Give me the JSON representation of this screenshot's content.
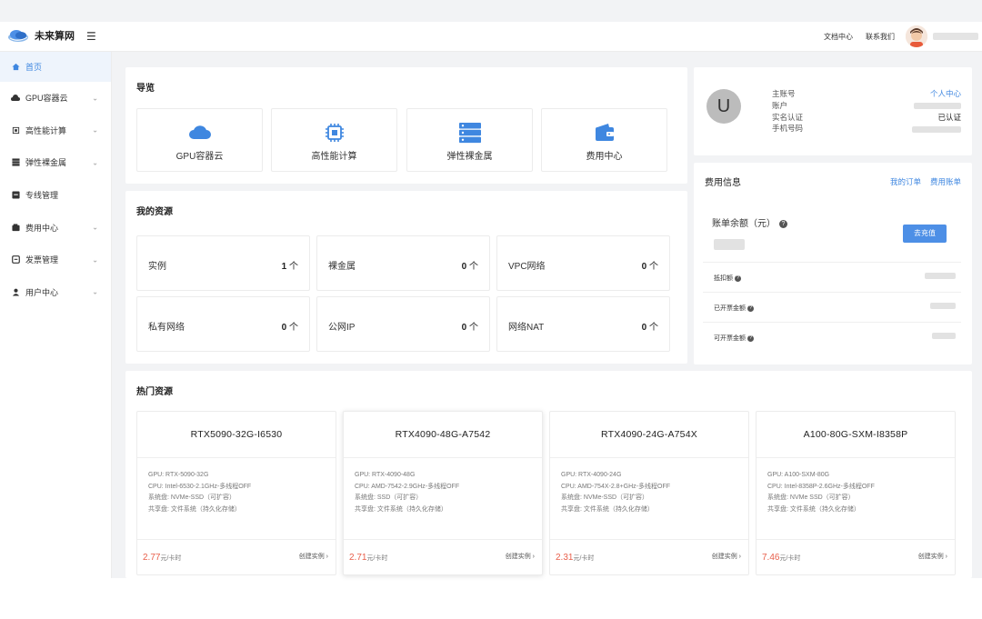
{
  "header": {
    "brand": "未来算网",
    "links": [
      "文档中心",
      "联系我们"
    ]
  },
  "sidebar": {
    "items": [
      {
        "label": "首页",
        "icon": "home-icon",
        "active": true,
        "chevron": false
      },
      {
        "label": "GPU容器云",
        "icon": "cloud-icon",
        "active": false,
        "chevron": true
      },
      {
        "label": "高性能计算",
        "icon": "chip-icon",
        "active": false,
        "chevron": true
      },
      {
        "label": "弹性裸金属",
        "icon": "server-icon",
        "active": false,
        "chevron": true
      },
      {
        "label": "专线管理",
        "icon": "line-icon",
        "active": false,
        "chevron": false
      },
      {
        "label": "费用中心",
        "icon": "wallet-icon",
        "active": false,
        "chevron": true
      },
      {
        "label": "发票管理",
        "icon": "invoice-icon",
        "active": false,
        "chevron": true
      },
      {
        "label": "用户中心",
        "icon": "user-icon",
        "active": false,
        "chevron": true
      }
    ]
  },
  "overview": {
    "title": "导览",
    "cards": [
      {
        "label": "GPU容器云",
        "icon": "cloud-icon"
      },
      {
        "label": "高性能计算",
        "icon": "chip-icon"
      },
      {
        "label": "弹性裸金属",
        "icon": "server-icon"
      },
      {
        "label": "费用中心",
        "icon": "wallet-icon"
      }
    ]
  },
  "resources": {
    "title": "我的资源",
    "items": [
      {
        "label": "实例",
        "count": "1",
        "unit": " 个"
      },
      {
        "label": "裸金属",
        "count": "0",
        "unit": " 个"
      },
      {
        "label": "VPC网络",
        "count": "0",
        "unit": " 个"
      },
      {
        "label": "私有网络",
        "count": "0",
        "unit": " 个"
      },
      {
        "label": "公网IP",
        "count": "0",
        "unit": " 个"
      },
      {
        "label": "网络NAT",
        "count": "0",
        "unit": " 个"
      }
    ]
  },
  "hot": {
    "title": "热门资源",
    "items": [
      {
        "name": "RTX5090-32G-I6530",
        "gpu": "GPU: RTX-5090-32G",
        "cpu": "CPU: Intel-6530-2.1GHz-多线程OFF",
        "disk": "系统盘: NVMe-SSD（可扩容）",
        "share": "共享盘: 文件系统（持久化存储）",
        "price": "2.77",
        "unit": "元/卡时",
        "action": "创建实例 ›"
      },
      {
        "name": "RTX4090-48G-A7542",
        "gpu": "GPU: RTX-4090-48G",
        "cpu": "CPU: AMD-7542-2.9GHz-多线程OFF",
        "disk": "系统盘: SSD（可扩容）",
        "share": "共享盘: 文件系统（持久化存储）",
        "price": "2.71",
        "unit": "元/卡时",
        "action": "创建实例 ›"
      },
      {
        "name": "RTX4090-24G-A754X",
        "gpu": "GPU: RTX-4090-24G",
        "cpu": "CPU: AMD-754X-2.8+GHz-多线程OFF",
        "disk": "系统盘: NVMe-SSD（可扩容）",
        "share": "共享盘: 文件系统（持久化存储）",
        "price": "2.31",
        "unit": "元/卡时",
        "action": "创建实例 ›"
      },
      {
        "name": "A100-80G-SXM-I8358P",
        "gpu": "GPU: A100-SXM-80G",
        "cpu": "CPU: Intel-8358P-2.6GHz-多线程OFF",
        "disk": "系统盘: NVMe SSD（可扩容）",
        "share": "共享盘: 文件系统（持久化存储）",
        "price": "7.46",
        "unit": "元/卡时",
        "action": "创建实例 ›"
      }
    ]
  },
  "account": {
    "avatar_letter": "U",
    "labels": [
      "主账号",
      "账户",
      "实名认证",
      "手机号码"
    ],
    "personal_center": "个人中心",
    "verified": "已认证"
  },
  "fees": {
    "title": "费用信息",
    "links": [
      "我的订单",
      "费用账单"
    ],
    "balance_label": "账单余额（元）",
    "recharge": "去充值",
    "rows": [
      "抵扣额",
      "已开票金额",
      "可开票金额"
    ]
  },
  "colors": {
    "accent": "#3f87e0",
    "price": "#e8604c",
    "button": "#4d8fe6"
  }
}
